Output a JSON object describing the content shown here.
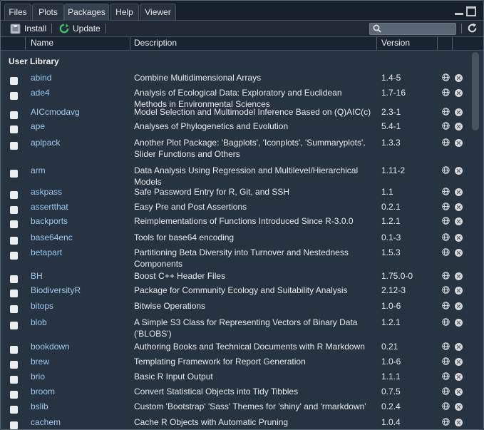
{
  "tabs": [
    {
      "label": "Files"
    },
    {
      "label": "Plots"
    },
    {
      "label": "Packages",
      "active": true
    },
    {
      "label": "Help"
    },
    {
      "label": "Viewer"
    }
  ],
  "toolbar": {
    "install_label": "Install",
    "update_label": "Update",
    "search_value": ""
  },
  "columns": {
    "name": "Name",
    "description": "Description",
    "version": "Version"
  },
  "group_label": "User Library",
  "packages": [
    {
      "name": "abind",
      "desc": "Combine Multidimensional Arrays",
      "version": "1.4-5"
    },
    {
      "name": "ade4",
      "desc": "Analysis of Ecological Data: Exploratory and Euclidean Methods in Environmental Sciences",
      "version": "1.7-16"
    },
    {
      "name": "AICcmodavg",
      "desc": "Model Selection and Multimodel Inference Based on (Q)AIC(c)",
      "version": "2.3-1"
    },
    {
      "name": "ape",
      "desc": "Analyses of Phylogenetics and Evolution",
      "version": "5.4-1"
    },
    {
      "name": "aplpack",
      "desc": "Another Plot Package: 'Bagplots', 'Iconplots', 'Summaryplots', Slider Functions and Others",
      "version": "1.3.3"
    },
    {
      "name": "arm",
      "desc": "Data Analysis Using Regression and Multilevel/Hierarchical Models",
      "version": "1.11-2"
    },
    {
      "name": "askpass",
      "desc": "Safe Password Entry for R, Git, and SSH",
      "version": "1.1"
    },
    {
      "name": "assertthat",
      "desc": "Easy Pre and Post Assertions",
      "version": "0.2.1"
    },
    {
      "name": "backports",
      "desc": "Reimplementations of Functions Introduced Since R-3.0.0",
      "version": "1.2.1"
    },
    {
      "name": "base64enc",
      "desc": "Tools for base64 encoding",
      "version": "0.1-3"
    },
    {
      "name": "betapart",
      "desc": "Partitioning Beta Diversity into Turnover and Nestedness Components",
      "version": "1.5.3"
    },
    {
      "name": "BH",
      "desc": "Boost C++ Header Files",
      "version": "1.75.0-0"
    },
    {
      "name": "BiodiversityR",
      "desc": "Package for Community Ecology and Suitability Analysis",
      "version": "2.12-3"
    },
    {
      "name": "bitops",
      "desc": "Bitwise Operations",
      "version": "1.0-6"
    },
    {
      "name": "blob",
      "desc": "A Simple S3 Class for Representing Vectors of Binary Data ('BLOBS')",
      "version": "1.2.1"
    },
    {
      "name": "bookdown",
      "desc": "Authoring Books and Technical Documents with R Markdown",
      "version": "0.21"
    },
    {
      "name": "brew",
      "desc": "Templating Framework for Report Generation",
      "version": "1.0-6"
    },
    {
      "name": "brio",
      "desc": "Basic R Input Output",
      "version": "1.1.1"
    },
    {
      "name": "broom",
      "desc": "Convert Statistical Objects into Tidy Tibbles",
      "version": "0.7.5"
    },
    {
      "name": "bslib",
      "desc": "Custom 'Bootstrap' 'Sass' Themes for 'shiny' and 'rmarkdown'",
      "version": "0.2.4"
    },
    {
      "name": "cachem",
      "desc": "Cache R Objects with Automatic Pruning",
      "version": "1.0.4"
    }
  ]
}
